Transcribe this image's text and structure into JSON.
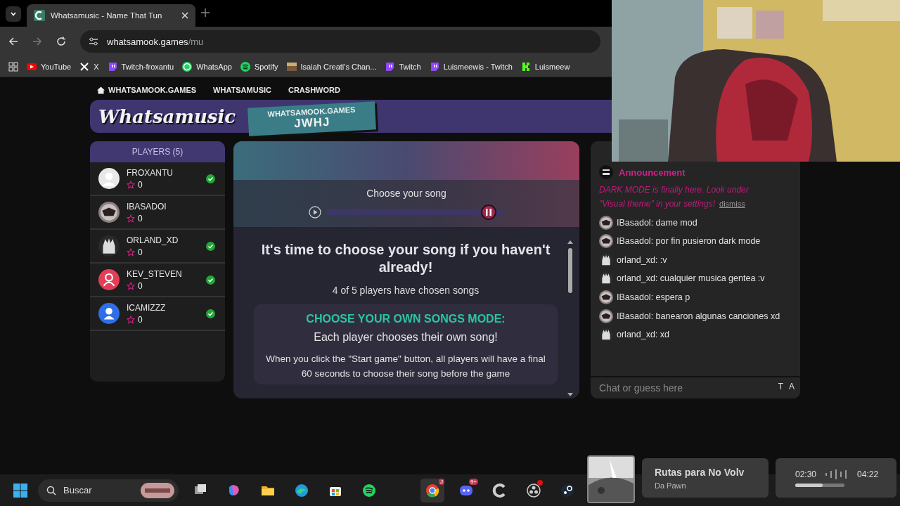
{
  "browser": {
    "tab_title": "Whatsamusic - Name That Tun",
    "address_host": "whatsamook.games",
    "address_path": "/mu",
    "bookmarks": [
      {
        "kind": "youtube",
        "label": "YouTube"
      },
      {
        "kind": "x",
        "label": "X"
      },
      {
        "kind": "twitch",
        "label": "Twitch-froxantu"
      },
      {
        "kind": "whatsapp",
        "label": "WhatsApp"
      },
      {
        "kind": "spotify",
        "label": "Spotify"
      },
      {
        "kind": "avatar",
        "label": "Isaiah Creati's Chan..."
      },
      {
        "kind": "twitch",
        "label": "Twitch"
      },
      {
        "kind": "twitch",
        "label": "Luismeewis - Twitch"
      },
      {
        "kind": "kick",
        "label": "Luismeew"
      }
    ]
  },
  "site_nav": [
    {
      "label": "WHATSAMOOK.GAMES",
      "kind": "home"
    },
    {
      "label": "WHATSAMUSIC",
      "kind": "link"
    },
    {
      "label": "CRASHWORD",
      "kind": "link"
    }
  ],
  "logo": "Whatsamusic",
  "room": {
    "site": "WHATSAMOOK.GAMES",
    "code": "JWHJ"
  },
  "players": {
    "title": "PLAYERS (5)",
    "items": [
      {
        "name": "FROXANTU",
        "score": "0",
        "chosen": true,
        "kind": "default"
      },
      {
        "name": "IBASADOI",
        "score": "0",
        "chosen": false,
        "kind": "dark"
      },
      {
        "name": "ORLAND_XD",
        "score": "0",
        "chosen": true,
        "kind": "anime"
      },
      {
        "name": "KEV_STEVEN",
        "score": "0",
        "chosen": true,
        "kind": "red"
      },
      {
        "name": "ICAMIZZZ",
        "score": "0",
        "chosen": true,
        "kind": "blue"
      }
    ]
  },
  "song_player": {
    "title": "Choose your song",
    "level": 0.95
  },
  "main": {
    "heading": "It's time to choose your song if you haven't already!",
    "status": "4 of 5 players have chosen songs",
    "mode_title": "CHOOSE YOUR OWN SONGS MODE:",
    "mode_subtitle": "Each player chooses their own song!",
    "description": "When you click the \"Start game\" button, all players will have a final 60 seconds to choose their song before the game"
  },
  "chat": {
    "announcement": {
      "title": "Announcement",
      "text": "DARK MODE is finally here. Look under \"Visual theme\" in your settings!",
      "dismiss": "dismiss"
    },
    "messages": [
      {
        "kind": "dark",
        "text": "IBasadol: dame mod"
      },
      {
        "kind": "dark",
        "text": "IBasadol: por fin pusieron dark mode"
      },
      {
        "kind": "anime",
        "text": "orland_xd: :v"
      },
      {
        "kind": "anime",
        "text": "orland_xd: cualquier musica gentea :v"
      },
      {
        "kind": "dark",
        "text": "IBasadol: espera p"
      },
      {
        "kind": "dark",
        "text": "IBasadol: banearon algunas canciones xd"
      },
      {
        "kind": "anime",
        "text": "orland_xd: xd"
      }
    ],
    "placeholder": "Chat or guess here",
    "buttons": [
      "T",
      "A"
    ]
  },
  "taskbar": {
    "search": "Buscar",
    "apps": [
      {
        "kind": "taskview"
      },
      {
        "kind": "copilot"
      },
      {
        "kind": "folder"
      },
      {
        "kind": "edge"
      },
      {
        "kind": "store"
      },
      {
        "kind": "spotify"
      },
      {
        "kind": "chrome",
        "selected": true,
        "badge": "J"
      },
      {
        "kind": "discord",
        "selected": false,
        "badge": "9+"
      },
      {
        "kind": "ccleaner"
      },
      {
        "kind": "obs",
        "badge_dot": true
      },
      {
        "kind": "steam"
      }
    ]
  },
  "media": {
    "title": "Rutas para No Volv",
    "artist": "Da Pawn",
    "elapsed": "02:30",
    "total": "04:22",
    "level": 0.55
  }
}
